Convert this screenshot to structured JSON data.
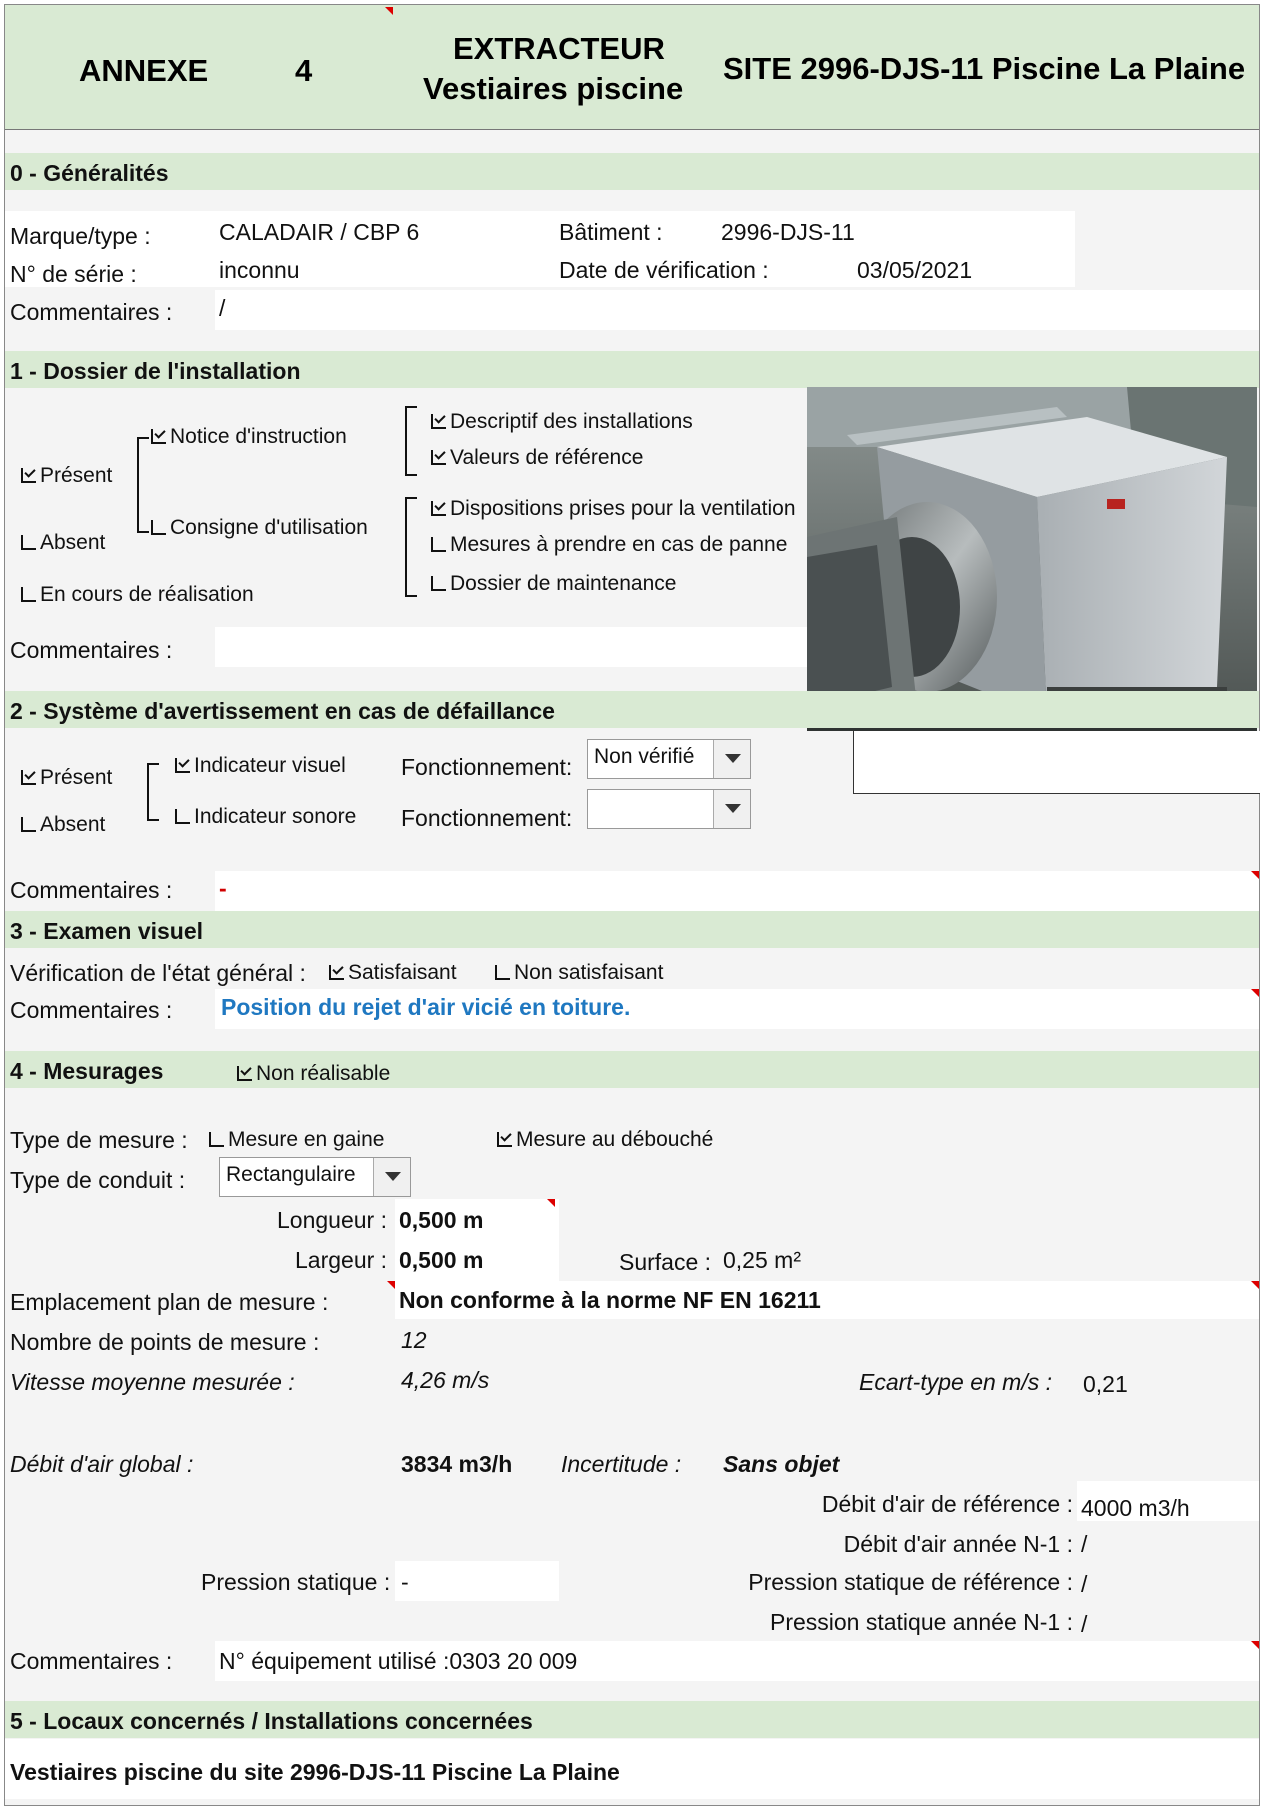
{
  "header": {
    "annexe_label": "ANNEXE",
    "annexe_num": "4",
    "title_line1": "EXTRACTEUR",
    "title_line2": "Vestiaires piscine",
    "site": "SITE 2996-DJS-11 Piscine La Plaine"
  },
  "s0": {
    "title": "0 - Généralités",
    "marque_label": "Marque/type :",
    "marque_value": "CALADAIR / CBP 6",
    "batiment_label": "Bâtiment :",
    "batiment_value": "2996-DJS-11",
    "serie_label": "N° de série :",
    "serie_value": "inconnu",
    "date_label": "Date de vérification :",
    "date_value": "03/05/2021",
    "comment_label": "Commentaires :",
    "comment_value": "/"
  },
  "s1": {
    "title": "1 - Dossier de l'installation",
    "present": "Présent",
    "absent": "Absent",
    "en_cours": "En cours de réalisation",
    "notice": "Notice d'instruction",
    "consigne": "Consigne d'utilisation",
    "descriptif": "Descriptif des installations",
    "valeurs": "Valeurs de référence",
    "dispositions": "Dispositions prises pour la ventilation",
    "mesures_panne": "Mesures à prendre en cas de panne",
    "maintenance": "Dossier de maintenance",
    "comment_label": "Commentaires :",
    "comment_value": "",
    "checked": {
      "present": true,
      "absent": false,
      "en_cours": false,
      "notice": true,
      "consigne": false,
      "descriptif": true,
      "valeurs": true,
      "dispositions": true,
      "mesures_panne": false,
      "maintenance": false
    }
  },
  "s2": {
    "title": "2 - Système d'avertissement en cas de défaillance",
    "present": "Présent",
    "absent": "Absent",
    "visuel": "Indicateur visuel",
    "sonore": "Indicateur sonore",
    "fonct_label": "Fonctionnement:",
    "fonct_visuel_value": "Non vérifié",
    "fonct_sonore_value": "",
    "comment_label": "Commentaires :",
    "comment_value": "-",
    "checked": {
      "present": true,
      "absent": false,
      "visuel": true,
      "sonore": false
    }
  },
  "s3": {
    "title": "3 - Examen visuel",
    "verif_label": "Vérification de l'état général :",
    "satisfaisant": "Satisfaisant",
    "non_satisfaisant": "Non satisfaisant",
    "comment_label": "Commentaires :",
    "comment_value": "Position du rejet d'air vicié en toiture.",
    "checked": {
      "satisfaisant": true,
      "non_satisfaisant": false
    }
  },
  "s4": {
    "title": "4 - Mesurages",
    "non_realisable": "Non réalisable",
    "type_mesure_label": "Type de mesure :",
    "mesure_gaine": "Mesure en gaine",
    "mesure_debouche": "Mesure au débouché",
    "type_conduit_label": "Type de conduit :",
    "type_conduit_value": "Rectangulaire",
    "longueur_label": "Longueur :",
    "longueur_value": "0,500 m",
    "largeur_label": "Largeur :",
    "largeur_value": "0,500 m",
    "surface_label": "Surface :",
    "surface_value": "0,25 m²",
    "emplacement_label": "Emplacement plan de mesure :",
    "emplacement_value": "Non conforme à la norme NF EN 16211",
    "nb_points_label": "Nombre de points de mesure :",
    "nb_points_value": "12",
    "vitesse_label": "Vitesse moyenne mesurée :",
    "vitesse_value": "4,26 m/s",
    "ecart_label": "Ecart-type en m/s :",
    "ecart_value": "0,21",
    "debit_label": "Débit d'air global :",
    "debit_value": "3834 m3/h",
    "incertitude_label": "Incertitude :",
    "incertitude_value": "Sans objet",
    "debit_ref_label": "Débit d'air de référence :",
    "debit_ref_value": "4000 m3/h",
    "debit_n1_label": "Débit d'air année N-1 :",
    "debit_n1_value": "/",
    "pression_label": "Pression statique :",
    "pression_value": "-",
    "pression_ref_label": "Pression statique de référence :",
    "pression_ref_value": "/",
    "pression_n1_label": "Pression statique année N-1 :",
    "pression_n1_value": "/",
    "comment_label": "Commentaires :",
    "comment_value": "N° équipement utilisé :0303 20 009",
    "checked": {
      "non_realisable": true,
      "mesure_gaine": false,
      "mesure_debouche": true
    }
  },
  "s5": {
    "title": "5 - Locaux concernés / Installations concernées",
    "value": "Vestiaires piscine du site 2996-DJS-11 Piscine La Plaine"
  },
  "colors": {
    "section_bg": "#d9ead3",
    "comment_blue": "#1f78c1",
    "marker_red": "#d00000"
  }
}
